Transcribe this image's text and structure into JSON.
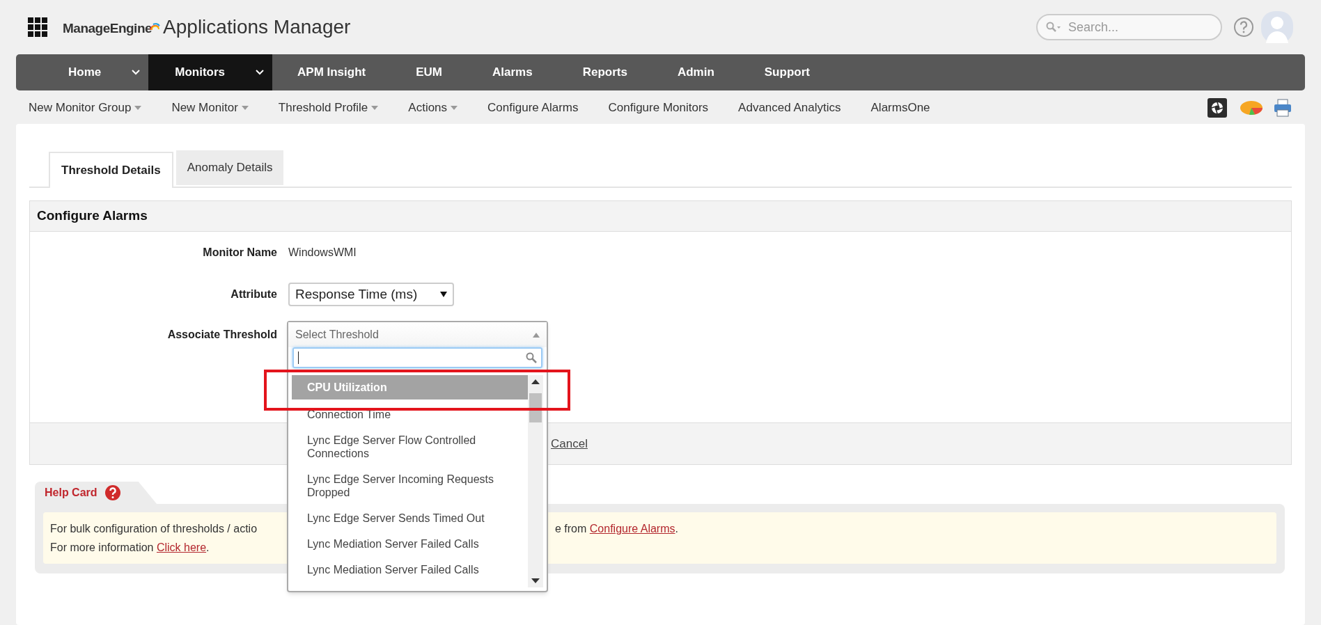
{
  "header": {
    "logo_brand": "ManageEngine",
    "logo_product": "Applications Manager",
    "search": {
      "placeholder": "Search..."
    }
  },
  "nav": [
    {
      "label": "Home",
      "selected": false,
      "has_menu": true
    },
    {
      "label": "Monitors",
      "selected": true,
      "has_menu": true
    },
    {
      "label": "APM Insight",
      "selected": false,
      "has_menu": false
    },
    {
      "label": "EUM",
      "selected": false,
      "has_menu": false
    },
    {
      "label": "Alarms",
      "selected": false,
      "has_menu": false
    },
    {
      "label": "Reports",
      "selected": false,
      "has_menu": false
    },
    {
      "label": "Admin",
      "selected": false,
      "has_menu": false
    },
    {
      "label": "Support",
      "selected": false,
      "has_menu": false
    }
  ],
  "sub_menu": [
    {
      "label": "New Monitor Group",
      "has_menu": true
    },
    {
      "label": "New Monitor",
      "has_menu": true
    },
    {
      "label": "Threshold Profile",
      "has_menu": true
    },
    {
      "label": "Actions",
      "has_menu": true
    },
    {
      "label": "Configure Alarms",
      "has_menu": false
    },
    {
      "label": "Configure Monitors",
      "has_menu": false
    },
    {
      "label": "Advanced Analytics",
      "has_menu": false
    },
    {
      "label": "AlarmsOne",
      "has_menu": false
    }
  ],
  "tabs": [
    {
      "label": "Threshold Details",
      "selected": true
    },
    {
      "label": "Anomaly Details",
      "selected": false
    }
  ],
  "section": {
    "title": "Configure Alarms",
    "fields": [
      {
        "kind": "text",
        "label": "Monitor Name",
        "value": "WindowsWMI"
      },
      {
        "kind": "select",
        "label": "Attribute",
        "value": "Response Time (ms)"
      },
      {
        "kind": "combo",
        "label": "Associate Threshold",
        "placeholder": "Select Threshold"
      }
    ],
    "cancel": "Cancel"
  },
  "dropdown": {
    "options": [
      {
        "label": "CPU Utilization",
        "selected": true
      },
      {
        "label": "Connection Time",
        "selected": false
      },
      {
        "label": "Lync Edge Server Flow Controlled Connections",
        "selected": false
      },
      {
        "label": "Lync Edge Server Incoming Requests Dropped",
        "selected": false
      },
      {
        "label": "Lync Edge Server Sends Timed Out",
        "selected": false
      },
      {
        "label": "Lync Mediation Server Failed Calls",
        "selected": false
      },
      {
        "label": "Lync Mediation Server Failed Calls",
        "selected": false
      }
    ]
  },
  "help_card": {
    "title": "Help Card",
    "line_1_start": "For bulk configuration of thresholds / actio",
    "line_1_end": "e from",
    "line_1_link": "Configure Alarms",
    "line_1_tail": ".",
    "line_2": "For more information",
    "line_2_link": "Click here",
    "line_2_tail": "."
  }
}
